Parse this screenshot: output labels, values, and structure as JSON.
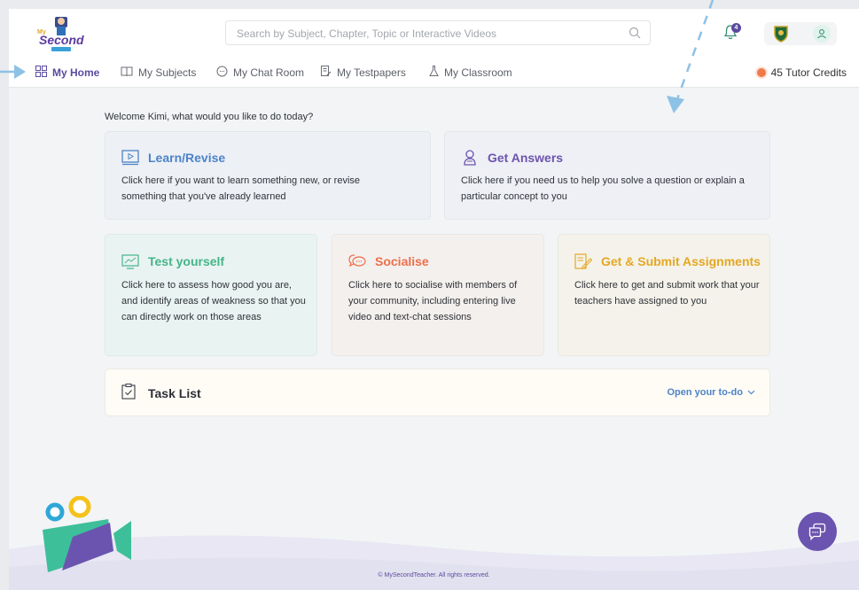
{
  "search": {
    "placeholder": "Search by Subject, Chapter, Topic or Interactive Videos"
  },
  "notifications": {
    "count": "4"
  },
  "nav": {
    "items": [
      {
        "label": "My Home",
        "active": true,
        "icon": "grid-icon"
      },
      {
        "label": "My Subjects",
        "active": false,
        "icon": "book-icon"
      },
      {
        "label": "My Chat Room",
        "active": false,
        "icon": "chat-bubble-icon"
      },
      {
        "label": "My Testpapers",
        "active": false,
        "icon": "document-edit-icon"
      },
      {
        "label": "My Classroom",
        "active": false,
        "icon": "flask-icon"
      }
    ],
    "credits": "45 Tutor Credits"
  },
  "welcome": "Welcome Kimi, what would you like to do today?",
  "cards": {
    "learn": {
      "title": "Learn/Revise",
      "desc": "Click here if you want to learn something new, or revise something that you've already learned",
      "color": "#4c83c9"
    },
    "answers": {
      "title": "Get Answers",
      "desc": "Click here if you need us to help you solve a question or explain a particular concept to you",
      "color": "#6e54ae"
    },
    "test": {
      "title": "Test yourself",
      "desc": "Click here to assess how good you are, and identify areas of weakness so that you can directly work on those areas",
      "color": "#45b48a"
    },
    "social": {
      "title": "Socialise",
      "desc": "Click here to socialise with members of your community, including entering live video and text-chat sessions",
      "color": "#ee6e4a"
    },
    "assign": {
      "title": "Get & Submit Assignments",
      "desc": "Click here to get and submit work that your teachers have assigned to you",
      "color": "#e4a823"
    }
  },
  "task": {
    "title": "Task List",
    "open_label": "Open your to-do"
  },
  "footer": "© MySecondTeacher. All rights reserved.",
  "colors": {
    "brand": "#5b4aa0",
    "accent_blue": "#4c83c9",
    "arrow": "#8ec1e6"
  }
}
